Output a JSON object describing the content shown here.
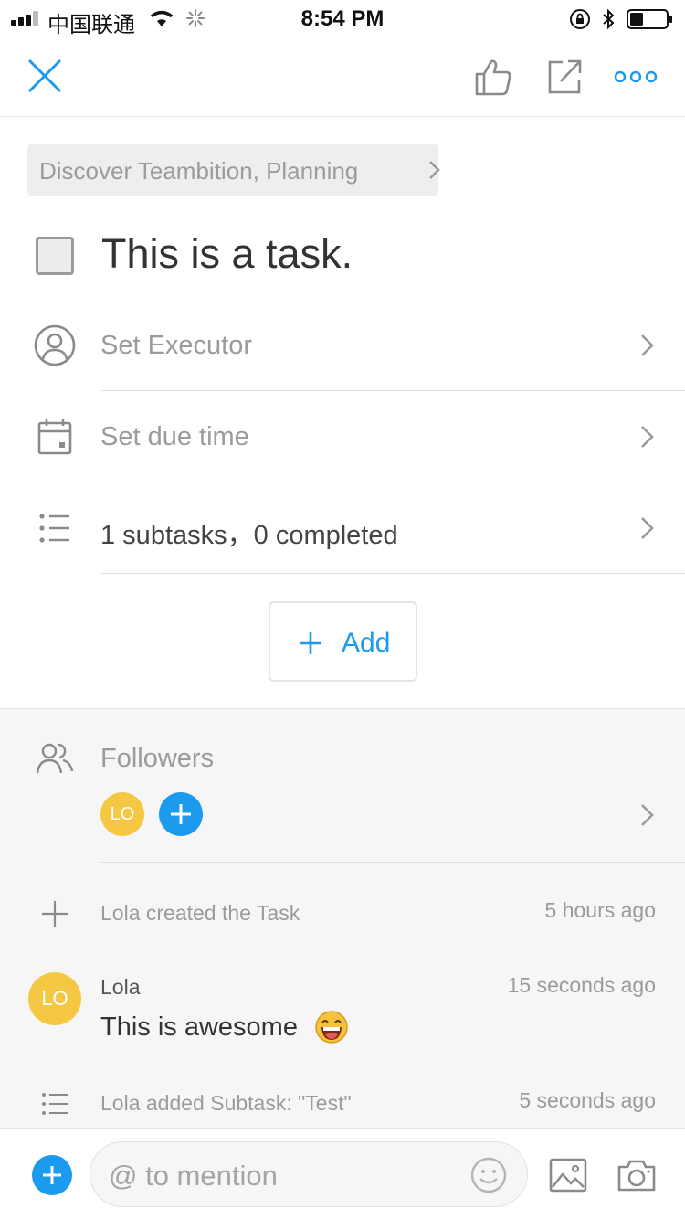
{
  "status_bar": {
    "carrier": "中国联通",
    "time": "8:54 PM"
  },
  "nav": {
    "close_icon": "close-icon",
    "like_icon": "thumbs-up-icon",
    "share_icon": "share-external-icon",
    "more_icon": "more-dots-icon"
  },
  "breadcrumb": {
    "text": "Discover Teambition, Planning"
  },
  "task": {
    "title": "This is a task.",
    "completed": false
  },
  "rows": {
    "executor": "Set Executor",
    "due_time": "Set due time",
    "subtasks": "1 subtasks，0 completed"
  },
  "add_button": {
    "label": "Add"
  },
  "followers": {
    "label": "Followers",
    "avatars": [
      "LO"
    ]
  },
  "activity": [
    {
      "text": "Lola created the Task",
      "time": "5 hours ago"
    },
    {
      "text": "Lola added Subtask: \"Test\"",
      "time": "5 seconds ago"
    }
  ],
  "comment": {
    "avatar": "LO",
    "author": "Lola",
    "time": "15 seconds ago",
    "body": "This is awesome"
  },
  "composer": {
    "placeholder": "@ to mention"
  },
  "colors": {
    "accent": "#1b9aee",
    "avatar": "#f5c843"
  }
}
